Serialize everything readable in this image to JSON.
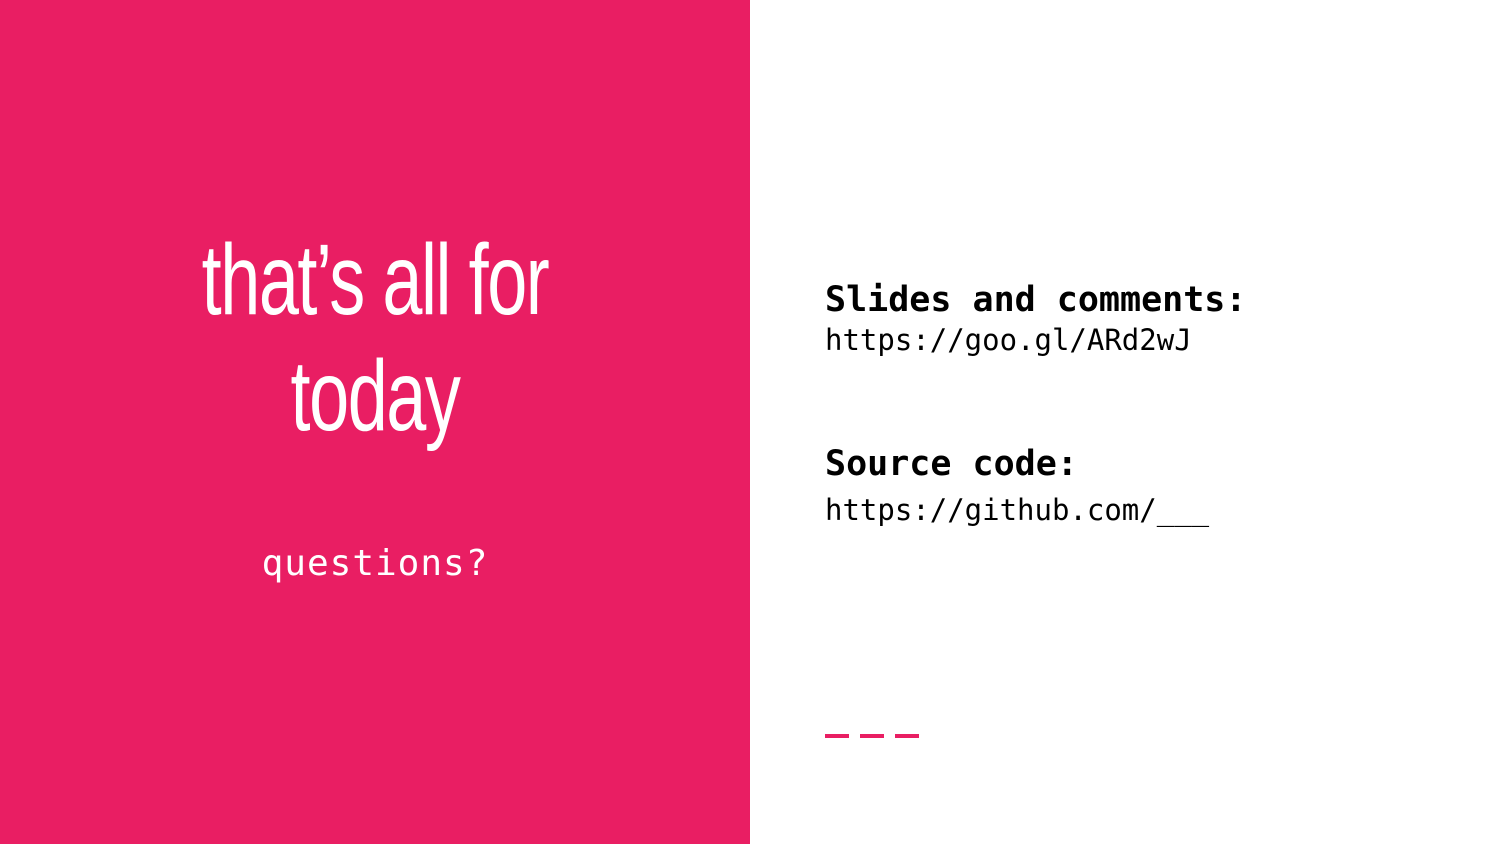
{
  "slide": {
    "title_line1": "that’s all for",
    "title_line2": "today",
    "subtitle": "questions?",
    "slides_heading": "Slides and comments:",
    "slides_link": "https://goo.gl/ARd2wJ",
    "source_heading": "Source code:",
    "source_link": "https://github.com/___"
  },
  "colors": {
    "accent": "#e91e63",
    "background": "#ffffff",
    "text_dark": "#000000",
    "text_light": "#ffffff"
  }
}
